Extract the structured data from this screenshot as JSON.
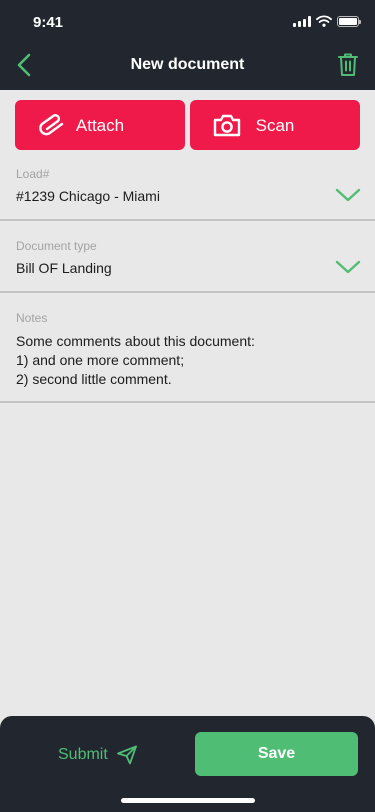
{
  "status_bar": {
    "time": "9:41"
  },
  "header": {
    "title": "New document"
  },
  "actions": {
    "attach_label": "Attach",
    "scan_label": "Scan"
  },
  "load": {
    "label": "Load#",
    "value": "#1239 Chicago - Miami"
  },
  "document_type": {
    "label": "Document type",
    "value": "Bill OF Landing"
  },
  "notes": {
    "label": "Notes",
    "lines": [
      "Some comments about this document:",
      "1) and one more comment;",
      "2) second little comment."
    ]
  },
  "footer": {
    "submit_label": "Submit",
    "save_label": "Save"
  },
  "icons": {
    "back": "chevron-left-icon",
    "delete": "trash-icon",
    "attach": "paperclip-icon",
    "scan": "camera-icon",
    "dropdown": "chevron-down-icon",
    "submit": "send-icon"
  },
  "colors": {
    "header_bg": "#22262f",
    "accent_red": "#ef1a4a",
    "accent_green": "#4fbd74",
    "content_bg": "#e8e8e8"
  }
}
